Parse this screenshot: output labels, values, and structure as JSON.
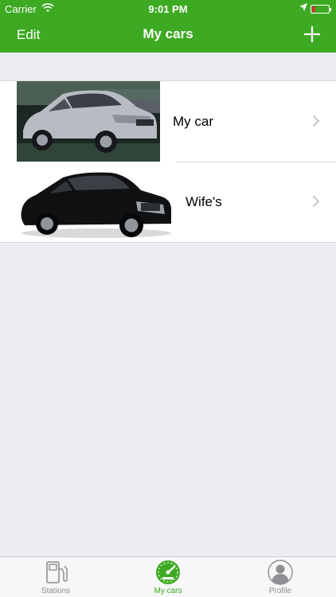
{
  "status_bar": {
    "carrier": "Carrier",
    "time": "9:01 PM",
    "battery_level": 0.2,
    "battery_color": "#e0302a",
    "icons": [
      "wifi-icon",
      "location-arrow-icon",
      "battery-icon"
    ]
  },
  "nav": {
    "edit_label": "Edit",
    "title": "My cars",
    "add_icon": "plus-icon",
    "color": "#3eaa23"
  },
  "cars": [
    {
      "name": "My car",
      "photo": "silver-suv-photo"
    },
    {
      "name": "Wife's",
      "photo": "black-sedan-photo"
    }
  ],
  "tabs": [
    {
      "label": "Stations",
      "icon": "fuel-pump-icon",
      "active": false
    },
    {
      "label": "My cars",
      "icon": "speedometer-icon",
      "active": true
    },
    {
      "label": "Profile",
      "icon": "profile-silhouette-icon",
      "active": false
    }
  ],
  "colors": {
    "accent": "#3eaa23",
    "background": "#ececf1",
    "inactive_tab": "#8e8e93"
  }
}
